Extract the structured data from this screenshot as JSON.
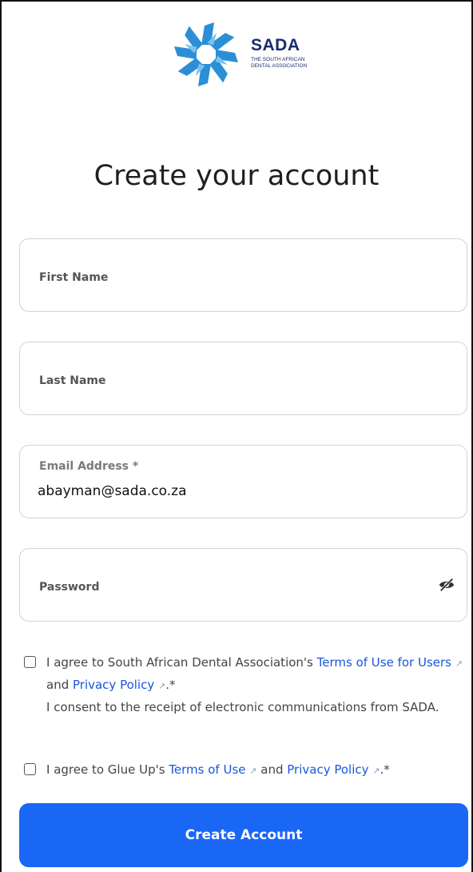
{
  "brand": {
    "name": "SADA",
    "subtitle_line1": "THE SOUTH AFRICAN",
    "subtitle_line2": "DENTAL ASSOCIATION",
    "logo_icon": "sada-starburst-logo",
    "colors": {
      "primary": "#1a2b6b",
      "accent": "#2c8fd6"
    }
  },
  "page_title": "Create your account",
  "form": {
    "first_name": {
      "label": "First Name",
      "value": ""
    },
    "last_name": {
      "label": "Last Name",
      "value": ""
    },
    "email": {
      "label": "Email Address *",
      "value": "abayman@sada.co.za"
    },
    "password": {
      "label": "Password",
      "value": "",
      "toggle_icon": "eye-slash-icon"
    }
  },
  "consents": [
    {
      "checked": false,
      "prefix": "I agree to South African Dental Association's ",
      "link1": "Terms of Use for Users",
      "middle": " and ",
      "link2": "Privacy Policy",
      "suffix": ".*",
      "extra": "I consent to the receipt of electronic communications from SADA."
    },
    {
      "checked": false,
      "prefix": "I agree to Glue Up's ",
      "link1": "Terms of Use",
      "middle": " and ",
      "link2": "Privacy Policy",
      "suffix": ".*"
    }
  ],
  "submit_label": "Create Account",
  "colors": {
    "button": "#1a66f5",
    "link": "#1a56db"
  }
}
